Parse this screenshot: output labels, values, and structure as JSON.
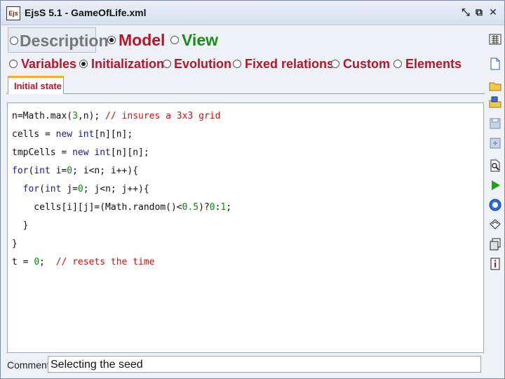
{
  "window": {
    "app_icon": "Ejs",
    "title": "EjsS 5.1 - GameOfLife.xml",
    "controls": [
      "restore-icon",
      "detach-icon",
      "close-icon"
    ]
  },
  "main_tabs": [
    {
      "label": "Description",
      "selected": false,
      "color": "#777777"
    },
    {
      "label": "Model",
      "selected": true,
      "color": "#b2182b"
    },
    {
      "label": "View",
      "selected": false,
      "color": "#1a8c1a"
    }
  ],
  "model_tabs": [
    {
      "label": "Variables",
      "selected": false
    },
    {
      "label": "Initialization",
      "selected": true
    },
    {
      "label": "Evolution",
      "selected": false
    },
    {
      "label": "Fixed relations",
      "selected": false
    },
    {
      "label": "Custom",
      "selected": false
    },
    {
      "label": "Elements",
      "selected": false
    }
  ],
  "page_tab": {
    "label": "Initial state"
  },
  "code_lines": [
    "n=Math.max(3,n); // insures a 3x3 grid",
    "cells = new int[n][n];",
    "tmpCells = new int[n][n];",
    "for(int i=0; i<n; i++){",
    "  for(int j=0; j<n; j++){",
    "    cells[i][j]=(Math.random()<0.5)?0:1;",
    "  }",
    "}",
    "t = 0;  // resets the time"
  ],
  "comment": {
    "label": "Comment",
    "value": "Selecting the seed"
  },
  "toolbar_icons": [
    "display-options-icon",
    "new-file-icon",
    "open-folder-icon",
    "open-model-icon",
    "save-icon",
    "save-as-icon",
    "search-icon",
    "run-icon",
    "help-icon",
    "bookmark-icon",
    "info-editor-icon",
    "information-icon"
  ],
  "colors": {
    "accent": "#b2182b",
    "keyword": "#1a1a8c",
    "comment": "#d01010",
    "number": "#0a8a0a"
  }
}
